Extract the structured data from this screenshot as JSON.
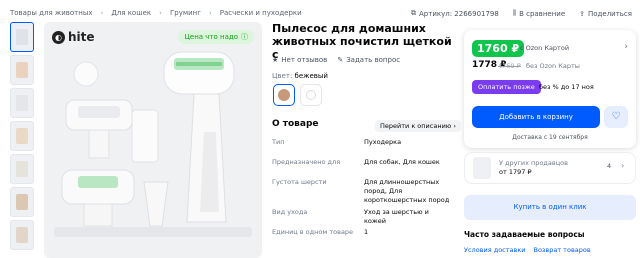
{
  "breadcrumbs": [
    "Товары для животных",
    "Для кошек",
    "Груминг",
    "Расчески и пуходерки"
  ],
  "top_actions": {
    "article": "Артикул: 2266901798",
    "compare": "В сравнение",
    "share": "Поделиться"
  },
  "gallery": {
    "brand_logo_text": "hite",
    "good_price_badge": "Цена что надо"
  },
  "product": {
    "title": "Пылесос для домашних животных почистил щеткой с",
    "reviews": "Нет отзывов",
    "ask_question": "Задать вопрос",
    "color_label": "Цвет:",
    "color_value": "бежевый",
    "swatch_colors": [
      "#c7997a",
      "#ffffff"
    ]
  },
  "about": {
    "title": "О товаре",
    "description_link": "Перейти к описанию",
    "specs": [
      {
        "key": "Тип",
        "value": "Пуходерка"
      },
      {
        "key": "Предназначено для",
        "value": "Для собак, Для кошек"
      },
      {
        "key": "Густота шерсти",
        "value": "Для длинношерстных пород, Для короткошерстных пород"
      },
      {
        "key": "Вид ухода",
        "value": "Уход за шерстью и кожей"
      },
      {
        "key": "Единиц в одном товаре",
        "value": "1"
      }
    ]
  },
  "price_card": {
    "card_price": "1760 ₽",
    "card_note": "с Ozon Картой",
    "price": "1778 ₽",
    "old_price": "4769 ₽",
    "price_note": "без Ozon Карты",
    "pay_later": "Оплатить позже",
    "split_note": "без % до 17 ноя",
    "add_to_cart": "Добавить в корзину",
    "delivery": "Доставка с 19 сентября"
  },
  "other_sellers": {
    "text": "У других продавцов",
    "price": "от 1797 ₽",
    "count": "4"
  },
  "one_click": "Купить в один клик",
  "faq": {
    "title": "Часто задаваемые вопросы",
    "links": [
      "Условия доставки",
      "Возврат товаров"
    ]
  },
  "colors": {
    "accent": "#005bff",
    "price_green": "#10c44c",
    "pay_later_purple": "#7b3cf0"
  }
}
